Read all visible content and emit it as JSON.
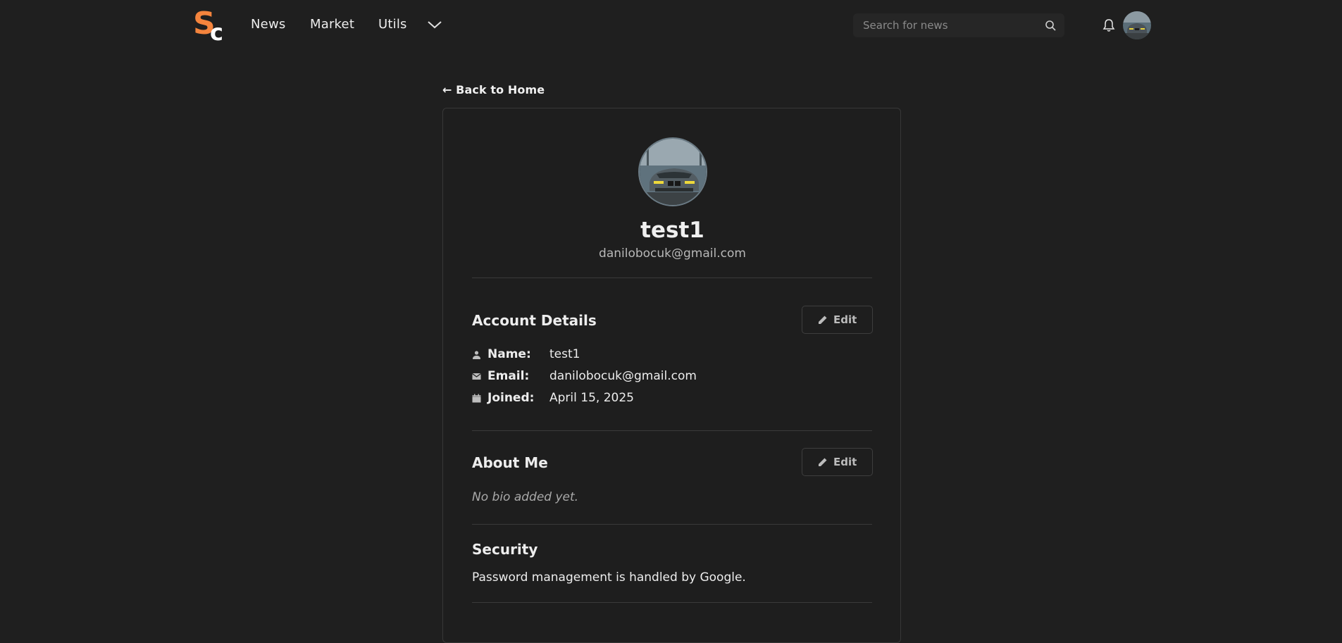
{
  "nav": {
    "logo_text": "SC",
    "links": [
      "News",
      "Market",
      "Utils"
    ],
    "dropdown_icon": "chevron-down-icon",
    "search_placeholder": "Search for news",
    "search_icon": "search-icon",
    "notifications_icon": "bell-icon",
    "avatar_alt": "user avatar"
  },
  "back_link": "← Back to Home",
  "profile": {
    "name": "test1",
    "email": "danilobocuk@gmail.com"
  },
  "account_details": {
    "title": "Account Details",
    "edit_label": "Edit",
    "rows": [
      {
        "icon": "person-icon",
        "label": "Name:",
        "value": "test1"
      },
      {
        "icon": "mail-icon",
        "label": "Email:",
        "value": "danilobocuk@gmail.com"
      },
      {
        "icon": "calendar-icon",
        "label": "Joined:",
        "value": "April 15, 2025"
      }
    ]
  },
  "about": {
    "title": "About Me",
    "edit_label": "Edit",
    "bio": "No bio added yet."
  },
  "security": {
    "title": "Security",
    "text": "Password management is handled by Google."
  },
  "colors": {
    "background": "#1f1f1f",
    "logo_orange": "#f4843d",
    "logo_white": "#ffffff",
    "text": "#ededed",
    "muted": "#a9a9a9"
  }
}
